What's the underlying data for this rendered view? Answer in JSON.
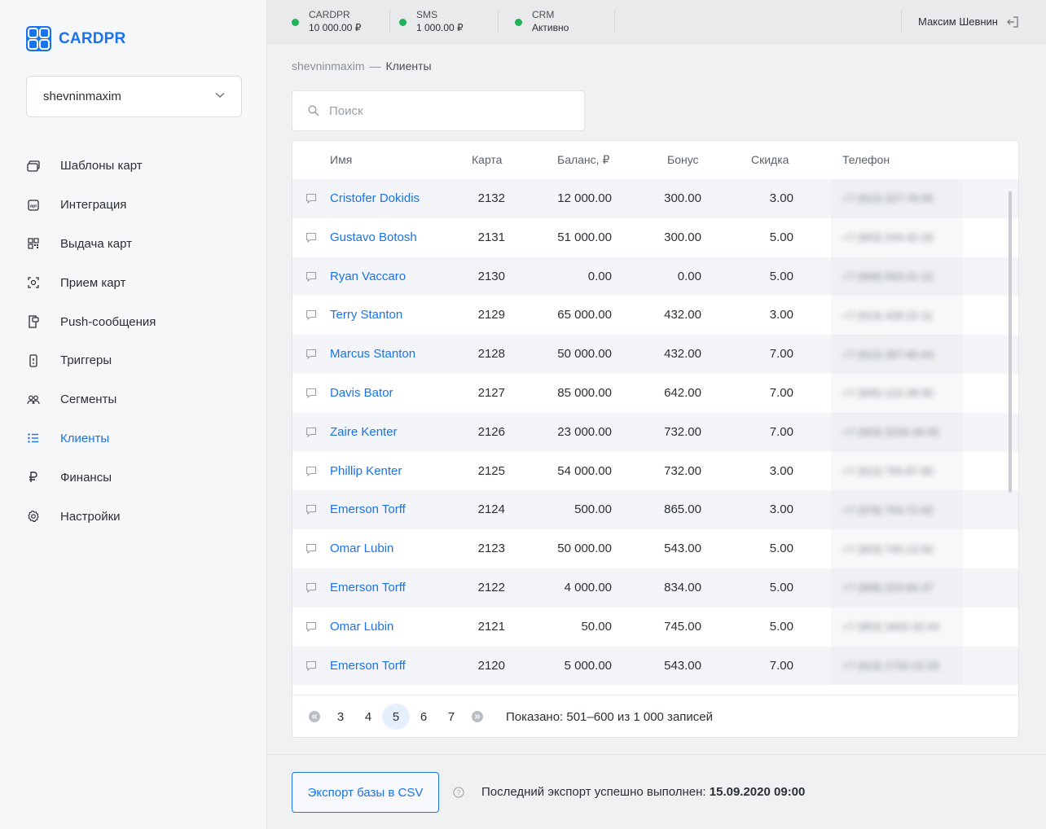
{
  "brand": {
    "name": "CARDPR",
    "logo_letters": "CARD"
  },
  "account": {
    "selected": "shevninmaxim"
  },
  "nav": [
    {
      "label": "Шаблоны карт",
      "icon": "card-template-icon",
      "active": false
    },
    {
      "label": "Интеграция",
      "icon": "api-icon",
      "active": false
    },
    {
      "label": "Выдача карт",
      "icon": "qr-code-icon",
      "active": false
    },
    {
      "label": "Прием карт",
      "icon": "scan-icon",
      "active": false
    },
    {
      "label": "Push-сообщения",
      "icon": "push-message-icon",
      "active": false
    },
    {
      "label": "Триггеры",
      "icon": "trigger-icon",
      "active": false
    },
    {
      "label": "Сегменты",
      "icon": "users-icon",
      "active": false
    },
    {
      "label": "Клиенты",
      "icon": "list-icon",
      "active": true
    },
    {
      "label": "Финансы",
      "icon": "ruble-icon",
      "active": false
    },
    {
      "label": "Настройки",
      "icon": "gear-icon",
      "active": false
    }
  ],
  "topbar": {
    "statuses": [
      {
        "label": "CARDPR",
        "value": "10 000.00 ₽"
      },
      {
        "label": "SMS",
        "value": "1 000.00 ₽"
      },
      {
        "label": "CRM",
        "value": "Активно"
      }
    ],
    "user": "Максим Шевнин"
  },
  "breadcrumb": {
    "parent": "shevninmaxim",
    "separator": "—",
    "current": "Клиенты"
  },
  "search": {
    "placeholder": "Поиск",
    "value": ""
  },
  "table": {
    "columns": {
      "name": "Имя",
      "card": "Карта",
      "balance": "Баланс, ₽",
      "bonus": "Бонус",
      "discount": "Скидка",
      "phone": "Телефон"
    },
    "rows": [
      {
        "name": "Cristofer Dokidis",
        "card": "2132",
        "balance": "12 000.00",
        "bonus": "300.00",
        "discount": "3.00",
        "phone": "+7 (913) 327-78-00"
      },
      {
        "name": "Gustavo Botosh",
        "card": "2131",
        "balance": "51 000.00",
        "bonus": "300.00",
        "discount": "5.00",
        "phone": "+7 (903) 234-32-33"
      },
      {
        "name": "Ryan Vaccaro",
        "card": "2130",
        "balance": "0.00",
        "bonus": "0.00",
        "discount": "5.00",
        "phone": "+7 (909) 563-31-12"
      },
      {
        "name": "Terry Stanton",
        "card": "2129",
        "balance": "65 000.00",
        "bonus": "432.00",
        "discount": "3.00",
        "phone": "+7 (913) 428-22-11"
      },
      {
        "name": "Marcus Stanton",
        "card": "2128",
        "balance": "50 000.00",
        "bonus": "432.00",
        "discount": "7.00",
        "phone": "+7 (913) 387-90-43"
      },
      {
        "name": "Davis Bator",
        "card": "2127",
        "balance": "85 000.00",
        "bonus": "642.00",
        "discount": "7.00",
        "phone": "+7 (905) 122-38-90"
      },
      {
        "name": "Zaire Kenter",
        "card": "2126",
        "balance": "23 000.00",
        "bonus": "732.00",
        "discount": "7.00",
        "phone": "+7 (903) 3234-34-55"
      },
      {
        "name": "Phillip Kenter",
        "card": "2125",
        "balance": "54 000.00",
        "bonus": "732.00",
        "discount": "3.00",
        "phone": "+7 (913) 765-87-90"
      },
      {
        "name": "Emerson Torff",
        "card": "2124",
        "balance": "500.00",
        "bonus": "865.00",
        "discount": "3.00",
        "phone": "+7 (978) 754-72-92"
      },
      {
        "name": "Omar Lubin",
        "card": "2123",
        "balance": "50 000.00",
        "bonus": "543.00",
        "discount": "5.00",
        "phone": "+7 (903) 745-12-92"
      },
      {
        "name": "Emerson Torff",
        "card": "2122",
        "balance": "4 000.00",
        "bonus": "834.00",
        "discount": "5.00",
        "phone": "+7 (908) 223-84-37"
      },
      {
        "name": "Omar Lubin",
        "card": "2121",
        "balance": "50.00",
        "bonus": "745.00",
        "discount": "5.00",
        "phone": "+7 (953) 3442-32-44"
      },
      {
        "name": "Emerson Torff",
        "card": "2120",
        "balance": "5 000.00",
        "bonus": "543.00",
        "discount": "7.00",
        "phone": "+7 (913) 1732-22-33"
      }
    ]
  },
  "pagination": {
    "pages": [
      "3",
      "4",
      "5",
      "6",
      "7"
    ],
    "current": "5",
    "info": "Показано: 501–600 из 1 000 записей"
  },
  "footer": {
    "export_button": "Экспорт базы в CSV",
    "export_text": "Последний экспорт успешно выполнен:",
    "export_date": "15.09.2020 09:00"
  },
  "colors": {
    "accent": "#1a73e8",
    "status_ok": "#22b05a"
  }
}
